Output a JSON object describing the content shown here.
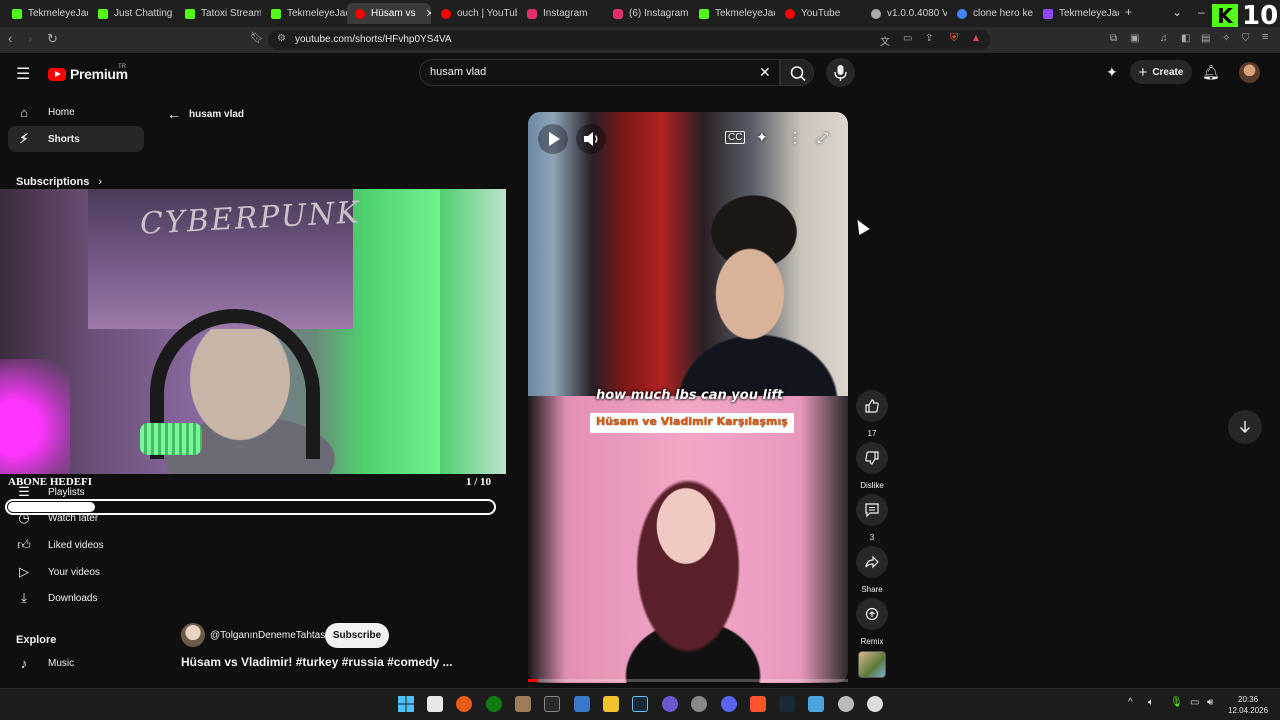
{
  "browser": {
    "tabs": [
      {
        "label": "TekmeleyeJack",
        "color": "#53fc18"
      },
      {
        "label": "Just Chatting S",
        "color": "#53fc18"
      },
      {
        "label": "Tatoxi Stream",
        "color": "#53fc18"
      },
      {
        "label": "TekmeleyeJack",
        "color": "#53fc18"
      },
      {
        "label": "Hüsam vs",
        "color": "#ff0000"
      },
      {
        "label": "ouch | YouTub",
        "color": "#ff0000"
      },
      {
        "label": "Instagram",
        "color": "#e1306c"
      },
      {
        "label": "(6) Instagram",
        "color": "#e1306c"
      },
      {
        "label": "TekmeleyeJack",
        "color": "#53fc18"
      },
      {
        "label": "YouTube",
        "color": "#ff0000"
      },
      {
        "label": "v1.0.0.4080 V1",
        "color": "#aaaaaa"
      },
      {
        "label": "clone hero key",
        "color": "#4285f4"
      },
      {
        "label": "TekmeleyeJack",
        "color": "#9146ff"
      }
    ],
    "url": "youtube.com/shorts/HFvhp0YS4VA",
    "kick_count": "10"
  },
  "header": {
    "logo_text": "Premium",
    "logo_tr": "TR",
    "search_value": "husam vlad",
    "create_label": "Create"
  },
  "sidebar": {
    "items_top": [
      {
        "label": "Home",
        "icon": "home-icon"
      },
      {
        "label": "Shorts",
        "icon": "shorts-icon"
      }
    ],
    "subscriptions_label": "Subscriptions",
    "items_you": [
      {
        "label": "Playlists",
        "icon": "playlists-icon"
      },
      {
        "label": "Watch later",
        "icon": "clock-icon"
      },
      {
        "label": "Liked videos",
        "icon": "thumbs-up-icon"
      },
      {
        "label": "Your videos",
        "icon": "play-box-icon"
      },
      {
        "label": "Downloads",
        "icon": "download-icon"
      }
    ],
    "explore_label": "Explore",
    "items_explore": [
      {
        "label": "Music",
        "icon": "music-icon"
      }
    ]
  },
  "back_query": "husam vlad",
  "overlay": {
    "poster_text": "CYBERPUNK",
    "goal_title": "ABONE HEDEFI",
    "goal_count": "1 / 10",
    "goal_fraction": 0.1
  },
  "player": {
    "caption_en": "how much lbs can you lift",
    "caption_tr": "Hüsam ve Vladimir Karşılaşmış",
    "progress_fraction": 0.03
  },
  "channel": {
    "handle": "@TolganınDenemeTahtası",
    "subscribe_label": "Subscribe",
    "title": "Hüsam vs Vladimir! #turkey #russia #comedy ..."
  },
  "actions": {
    "like_count": "17",
    "dislike_label": "Dislike",
    "comment_count": "3",
    "share_label": "Share",
    "remix_label": "Remix"
  },
  "taskbar": {
    "time": "20:36",
    "date": "12.04.2026"
  }
}
